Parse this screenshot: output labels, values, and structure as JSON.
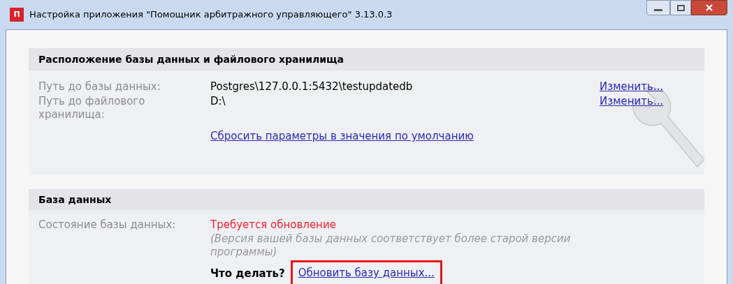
{
  "window": {
    "title": "Настройка приложения \"Помощник арбитражного управляющего\" 3.13.0.3",
    "app_icon": "П"
  },
  "storage_section": {
    "title": "Расположение базы данных и файлового хранилища",
    "rows": [
      {
        "label": "Путь до базы данных:",
        "value": "Postgres\\127.0.0.1:5432\\testupdatedb",
        "action": "Изменить..."
      },
      {
        "label": "Путь до файлового хранилища:",
        "value": "D:\\",
        "action": "Изменить..."
      }
    ],
    "reset_link": "Сбросить параметры в значения по умолчанию"
  },
  "database_section": {
    "title": "База данных",
    "status_label": "Состояние базы данных:",
    "status": "Требуется обновление",
    "note": "(Версия вашей базы данных соответствует более старой версии программы)",
    "todo_label": "Что делать?",
    "update_link": "Обновить базу данных...",
    "update_link_highlighted": true
  }
}
